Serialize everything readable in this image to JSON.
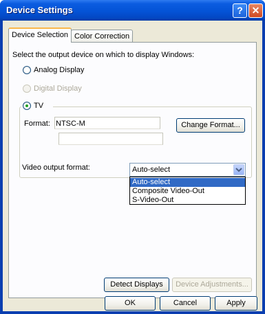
{
  "window": {
    "title": "Device Settings",
    "help_label": "?",
    "close_label": "✕"
  },
  "tabs": [
    {
      "label": "Device Selection",
      "active": true
    },
    {
      "label": "Color Correction",
      "active": false
    }
  ],
  "device_selection": {
    "prompt": "Select the output device on which to display Windows:",
    "options": [
      {
        "label": "Analog Display",
        "enabled": true,
        "selected": false
      },
      {
        "label": "Digital Display",
        "enabled": false,
        "selected": false
      },
      {
        "label": "TV",
        "enabled": true,
        "selected": true
      }
    ]
  },
  "tv": {
    "format_label": "Format:",
    "format_value": "NTSC-M",
    "format_secondary_value": "",
    "change_format_label": "Change Format..."
  },
  "video_output": {
    "label": "Video output format:",
    "selected": "Auto-select",
    "options": [
      "Auto-select",
      "Composite Video-Out",
      "S-Video-Out"
    ],
    "highlighted_index": 0
  },
  "actions": {
    "detect_displays": "Detect Displays",
    "device_adjustments": "Device Adjustments..."
  },
  "footer": {
    "ok": "OK",
    "cancel": "Cancel",
    "apply": "Apply"
  }
}
